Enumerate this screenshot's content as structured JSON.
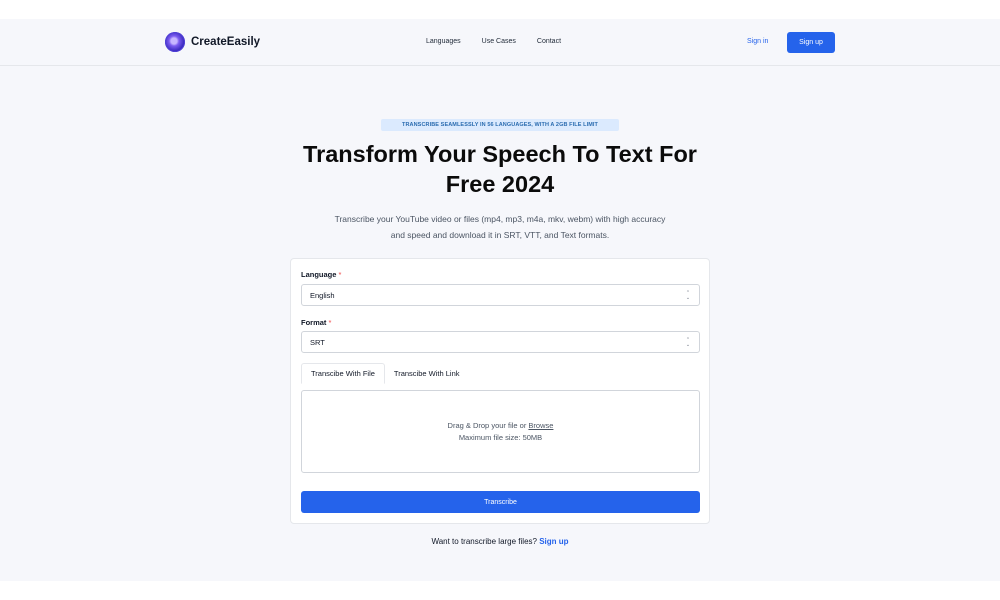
{
  "header": {
    "brand": "CreateEasily",
    "nav": [
      "Languages",
      "Use Cases",
      "Contact"
    ],
    "sign_in": "Sign in",
    "sign_up": "Sign up"
  },
  "hero": {
    "badge": "TRANSCRIBE SEAMLESSLY IN 56 LANGUAGES, WITH A 2GB FILE LIMIT",
    "title_line1": "Transform Your Speech To Text For",
    "title_line2": "Free 2024",
    "subtitle_line1": "Transcribe your YouTube video or files (mp4, mp3, m4a, mkv, webm) with high accuracy",
    "subtitle_line2": "and speed and download it in SRT, VTT, and Text formats."
  },
  "form": {
    "language_label": "Language",
    "language_value": "English",
    "format_label": "Format",
    "format_value": "SRT",
    "required_mark": "*",
    "tabs": [
      "Transcibe With File",
      "Transcibe With Link"
    ],
    "active_tab": 0,
    "dropzone_text": "Drag & Drop your file or ",
    "dropzone_browse": "Browse",
    "dropzone_limit": "Maximum file size: 50MB",
    "submit": "Transcribe"
  },
  "footer": {
    "prompt": "Want to transcribe large files?",
    "link": "Sign up"
  },
  "colors": {
    "accent": "#2563eb",
    "badge_bg": "#dbeafe",
    "page_bg": "#f6f7fb",
    "required": "#ef4444"
  },
  "icons": {
    "logo": "createeasily-logo-icon",
    "select_chevron": "up-down-chevron-icon"
  }
}
